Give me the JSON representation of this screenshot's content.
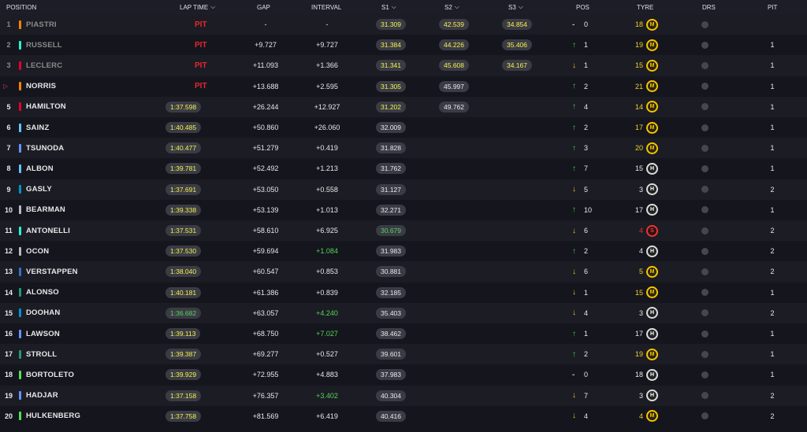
{
  "header": {
    "position": "POSITION",
    "laptime": "LAP TIME",
    "gap": "GAP",
    "interval": "INTERVAL",
    "s1": "S1",
    "s2": "S2",
    "s3": "S3",
    "pos": "POS",
    "tyre": "TYRE",
    "drs": "DRS",
    "pit": "PIT"
  },
  "colors": {
    "pit_red": "#e8262b",
    "purple_green": "#53d653",
    "personal_yellow": "#f2f249",
    "up_green": "#43d043",
    "down_yellow": "#f4c11b"
  },
  "rows": [
    {
      "pos": "1",
      "driver": "PIASTRI",
      "team_color": "#ff8000",
      "out": true,
      "laptime": "PIT",
      "laptime_kind": "pit",
      "gap": "-",
      "interval": "-",
      "interval_color": "white",
      "s1": "31.309",
      "s1_color": "yellow",
      "s2": "42.539",
      "s2_color": "yellow",
      "s3": "34.854",
      "s3_color": "yellow",
      "pos_change_dir": "same",
      "pos_change": "0",
      "tyre_age": "18",
      "tyre": "M",
      "pit": ""
    },
    {
      "pos": "2",
      "driver": "RUSSELL",
      "team_color": "#27f4d2",
      "out": true,
      "laptime": "PIT",
      "laptime_kind": "pit",
      "gap": "+9.727",
      "interval": "+9.727",
      "interval_color": "white",
      "s1": "31.384",
      "s1_color": "yellow",
      "s2": "44.226",
      "s2_color": "yellow",
      "s3": "35.406",
      "s3_color": "yellow",
      "pos_change_dir": "up",
      "pos_change": "1",
      "tyre_age": "19",
      "tyre": "M",
      "pit": "1"
    },
    {
      "pos": "3",
      "driver": "LECLERC",
      "team_color": "#e8002d",
      "out": true,
      "laptime": "PIT",
      "laptime_kind": "pit",
      "gap": "+11.093",
      "interval": "+1.366",
      "interval_color": "white",
      "s1": "31.341",
      "s1_color": "yellow",
      "s2": "45.608",
      "s2_color": "yellow",
      "s3": "34.167",
      "s3_color": "yellow",
      "pos_change_dir": "down",
      "pos_change": "1",
      "tyre_age": "15",
      "tyre": "M",
      "pit": "1"
    },
    {
      "pos": "",
      "marker": "▷",
      "driver": "NORRIS",
      "team_color": "#ff8000",
      "out": false,
      "laptime": "PIT",
      "laptime_kind": "pit",
      "gap": "+13.688",
      "interval": "+2.595",
      "interval_color": "white",
      "s1": "31.305",
      "s1_color": "yellow",
      "s2": "45.997",
      "s2_color": "white",
      "s3": "",
      "s3_color": "white",
      "pos_change_dir": "up",
      "pos_change": "2",
      "tyre_age": "21",
      "tyre": "M",
      "pit": "1"
    },
    {
      "pos": "5",
      "driver": "HAMILTON",
      "team_color": "#e8002d",
      "out": false,
      "laptime": "1:37.598",
      "laptime_kind": "yellow",
      "gap": "+26.244",
      "interval": "+12.927",
      "interval_color": "white",
      "s1": "31.202",
      "s1_color": "yellow",
      "s2": "49.762",
      "s2_color": "white",
      "s3": "",
      "s3_color": "white",
      "pos_change_dir": "up",
      "pos_change": "4",
      "tyre_age": "14",
      "tyre": "M",
      "pit": "1"
    },
    {
      "pos": "6",
      "driver": "SAINZ",
      "team_color": "#64c4ff",
      "out": false,
      "laptime": "1:40.485",
      "laptime_kind": "yellow",
      "gap": "+50.860",
      "interval": "+26.060",
      "interval_color": "white",
      "s1": "32.009",
      "s1_color": "white",
      "s2": "",
      "s2_color": "white",
      "s3": "",
      "s3_color": "white",
      "pos_change_dir": "up",
      "pos_change": "2",
      "tyre_age": "17",
      "tyre": "M",
      "pit": "1"
    },
    {
      "pos": "7",
      "driver": "TSUNODA",
      "team_color": "#6692ff",
      "out": false,
      "laptime": "1:40.477",
      "laptime_kind": "yellow",
      "gap": "+51.279",
      "interval": "+0.419",
      "interval_color": "white",
      "s1": "31.828",
      "s1_color": "white",
      "s2": "",
      "s2_color": "white",
      "s3": "",
      "s3_color": "white",
      "pos_change_dir": "up",
      "pos_change": "3",
      "tyre_age": "20",
      "tyre": "M",
      "pit": "1"
    },
    {
      "pos": "8",
      "driver": "ALBON",
      "team_color": "#64c4ff",
      "out": false,
      "laptime": "1:39.781",
      "laptime_kind": "yellow",
      "gap": "+52.492",
      "interval": "+1.213",
      "interval_color": "white",
      "s1": "31.762",
      "s1_color": "white",
      "s2": "",
      "s2_color": "white",
      "s3": "",
      "s3_color": "white",
      "pos_change_dir": "up",
      "pos_change": "7",
      "tyre_age": "15",
      "tyre": "H",
      "pit": "1"
    },
    {
      "pos": "9",
      "driver": "GASLY",
      "team_color": "#0093cc",
      "out": false,
      "laptime": "1:37.691",
      "laptime_kind": "yellow",
      "gap": "+53.050",
      "interval": "+0.558",
      "interval_color": "white",
      "s1": "31.127",
      "s1_color": "white",
      "s2": "",
      "s2_color": "white",
      "s3": "",
      "s3_color": "white",
      "pos_change_dir": "down",
      "pos_change": "5",
      "tyre_age": "3",
      "tyre": "H",
      "pit": "2"
    },
    {
      "pos": "10",
      "driver": "BEARMAN",
      "team_color": "#b6babd",
      "out": false,
      "laptime": "1:39.338",
      "laptime_kind": "yellow",
      "gap": "+53.139",
      "interval": "+1.013",
      "interval_color": "white",
      "s1": "32.271",
      "s1_color": "white",
      "s2": "",
      "s2_color": "white",
      "s3": "",
      "s3_color": "white",
      "pos_change_dir": "up",
      "pos_change": "10",
      "tyre_age": "17",
      "tyre": "H",
      "pit": "1"
    },
    {
      "pos": "11",
      "driver": "ANTONELLI",
      "team_color": "#27f4d2",
      "out": false,
      "laptime": "1:37.531",
      "laptime_kind": "yellow",
      "gap": "+58.610",
      "interval": "+6.925",
      "interval_color": "white",
      "s1": "30.679",
      "s1_color": "green",
      "s2": "",
      "s2_color": "white",
      "s3": "",
      "s3_color": "white",
      "pos_change_dir": "down",
      "pos_change": "6",
      "tyre_age": "4",
      "tyre": "S",
      "pit": "2"
    },
    {
      "pos": "12",
      "driver": "OCON",
      "team_color": "#b6babd",
      "out": false,
      "laptime": "1:37.530",
      "laptime_kind": "yellow",
      "gap": "+59.694",
      "interval": "+1.084",
      "interval_color": "green",
      "s1": "31.983",
      "s1_color": "white",
      "s2": "",
      "s2_color": "white",
      "s3": "",
      "s3_color": "white",
      "pos_change_dir": "up",
      "pos_change": "2",
      "tyre_age": "4",
      "tyre": "H",
      "pit": "2"
    },
    {
      "pos": "13",
      "driver": "VERSTAPPEN",
      "team_color": "#3671c6",
      "out": false,
      "laptime": "1:38.040",
      "laptime_kind": "yellow",
      "gap": "+60.547",
      "interval": "+0.853",
      "interval_color": "white",
      "s1": "30.881",
      "s1_color": "white",
      "s2": "",
      "s2_color": "white",
      "s3": "",
      "s3_color": "white",
      "pos_change_dir": "down",
      "pos_change": "6",
      "tyre_age": "5",
      "tyre": "M",
      "pit": "2"
    },
    {
      "pos": "14",
      "driver": "ALONSO",
      "team_color": "#229971",
      "out": false,
      "laptime": "1:40.181",
      "laptime_kind": "yellow",
      "gap": "+61.386",
      "interval": "+0.839",
      "interval_color": "white",
      "s1": "32.185",
      "s1_color": "white",
      "s2": "",
      "s2_color": "white",
      "s3": "",
      "s3_color": "white",
      "pos_change_dir": "down",
      "pos_change": "1",
      "tyre_age": "15",
      "tyre": "M",
      "pit": "1"
    },
    {
      "pos": "15",
      "driver": "DOOHAN",
      "team_color": "#0093cc",
      "out": false,
      "laptime": "1:36.682",
      "laptime_kind": "green",
      "gap": "+63.057",
      "interval": "+4.240",
      "interval_color": "green",
      "s1": "35.403",
      "s1_color": "white",
      "s2": "",
      "s2_color": "white",
      "s3": "",
      "s3_color": "white",
      "pos_change_dir": "down",
      "pos_change": "4",
      "tyre_age": "3",
      "tyre": "H",
      "pit": "2"
    },
    {
      "pos": "16",
      "driver": "LAWSON",
      "team_color": "#6692ff",
      "out": false,
      "laptime": "1:39.113",
      "laptime_kind": "yellow",
      "gap": "+68.750",
      "interval": "+7.027",
      "interval_color": "green",
      "s1": "38.462",
      "s1_color": "white",
      "s2": "",
      "s2_color": "white",
      "s3": "",
      "s3_color": "white",
      "pos_change_dir": "up",
      "pos_change": "1",
      "tyre_age": "17",
      "tyre": "H",
      "pit": "1"
    },
    {
      "pos": "17",
      "driver": "STROLL",
      "team_color": "#229971",
      "out": false,
      "laptime": "1:39.387",
      "laptime_kind": "yellow",
      "gap": "+69.277",
      "interval": "+0.527",
      "interval_color": "white",
      "s1": "39.601",
      "s1_color": "white",
      "s2": "",
      "s2_color": "white",
      "s3": "",
      "s3_color": "white",
      "pos_change_dir": "up",
      "pos_change": "2",
      "tyre_age": "19",
      "tyre": "M",
      "pit": "1"
    },
    {
      "pos": "18",
      "driver": "BORTOLETO",
      "team_color": "#52e252",
      "out": false,
      "laptime": "1:39.929",
      "laptime_kind": "yellow",
      "gap": "+72.955",
      "interval": "+4.883",
      "interval_color": "white",
      "s1": "37.983",
      "s1_color": "white",
      "s2": "",
      "s2_color": "white",
      "s3": "",
      "s3_color": "white",
      "pos_change_dir": "same",
      "pos_change": "0",
      "tyre_age": "18",
      "tyre": "H",
      "pit": "1"
    },
    {
      "pos": "19",
      "driver": "HADJAR",
      "team_color": "#6692ff",
      "out": false,
      "laptime": "1:37.158",
      "laptime_kind": "yellow",
      "gap": "+76.357",
      "interval": "+3.402",
      "interval_color": "green",
      "s1": "40.304",
      "s1_color": "white",
      "s2": "",
      "s2_color": "white",
      "s3": "",
      "s3_color": "white",
      "pos_change_dir": "down",
      "pos_change": "7",
      "tyre_age": "3",
      "tyre": "H",
      "pit": "2"
    },
    {
      "pos": "20",
      "driver": "HULKENBERG",
      "team_color": "#52e252",
      "out": false,
      "laptime": "1:37.758",
      "laptime_kind": "yellow",
      "gap": "+81.569",
      "interval": "+6.419",
      "interval_color": "white",
      "s1": "40.416",
      "s1_color": "white",
      "s2": "",
      "s2_color": "white",
      "s3": "",
      "s3_color": "white",
      "pos_change_dir": "down",
      "pos_change": "4",
      "tyre_age": "4",
      "tyre": "M",
      "pit": "2"
    }
  ]
}
